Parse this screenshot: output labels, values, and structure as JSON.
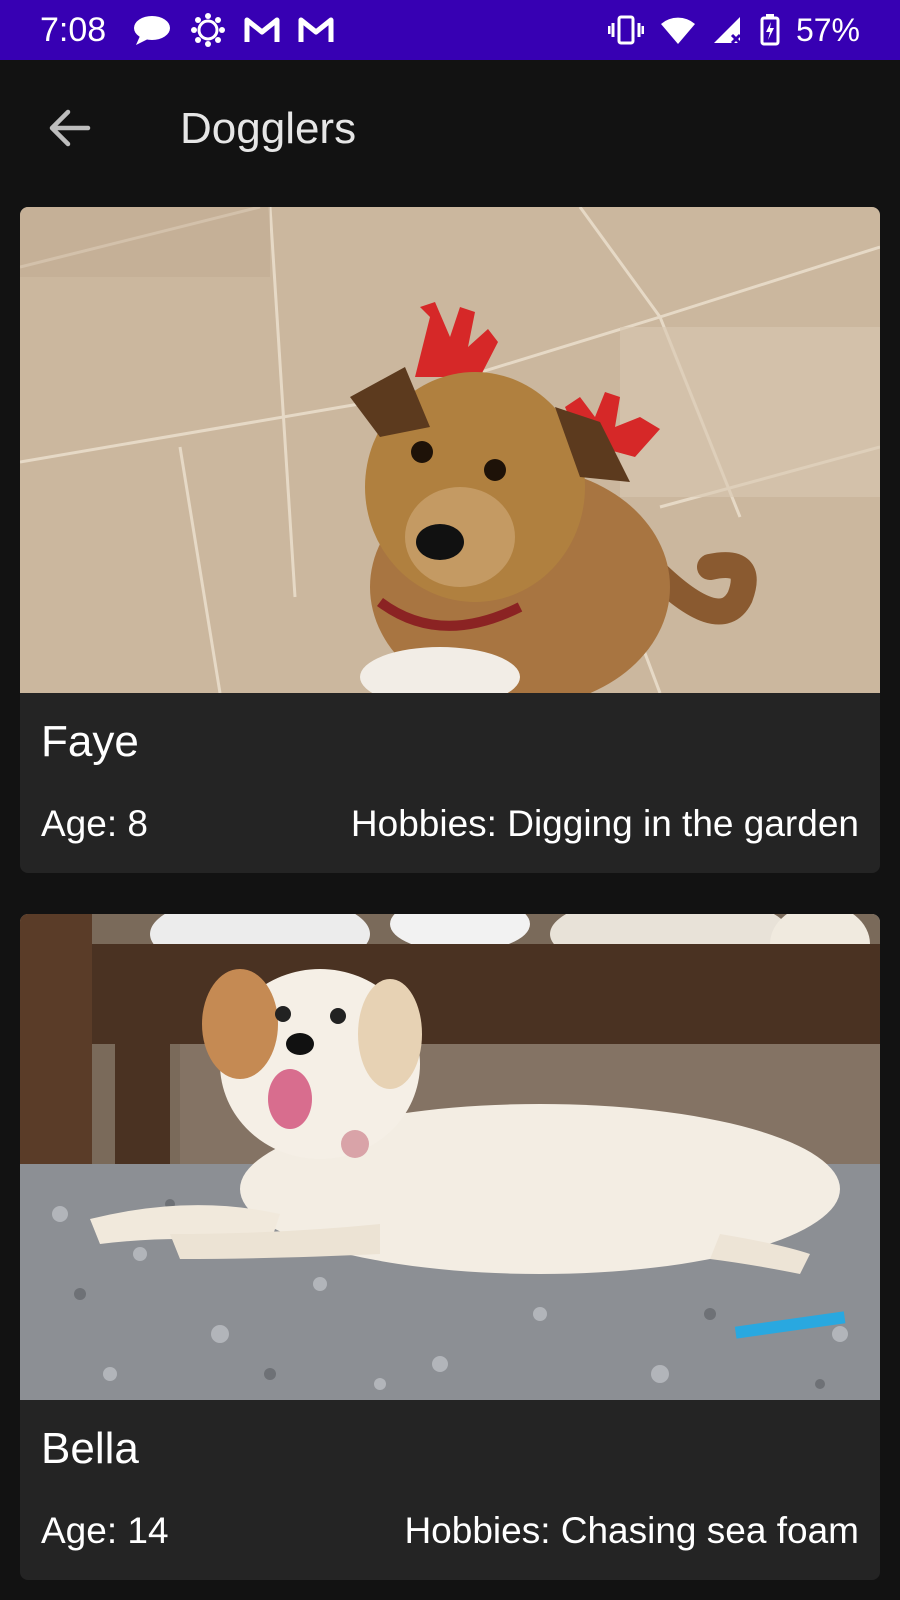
{
  "status_bar": {
    "time": "7:08",
    "battery": "57%",
    "bg_color": "#3700b3"
  },
  "app_bar": {
    "title": "Dogglers",
    "back_icon": "arrow-back-icon"
  },
  "dogs": [
    {
      "name": "Faye",
      "age": "Age: 8",
      "hobbies": "Hobbies: Digging in the garden",
      "photo_icon": "dog-photo-faye"
    },
    {
      "name": "Bella",
      "age": "Age: 14",
      "hobbies": "Hobbies: Chasing sea foam",
      "photo_icon": "dog-photo-bella"
    }
  ],
  "colors": {
    "background": "#121212",
    "card": "#242424",
    "text": "#ffffff"
  }
}
